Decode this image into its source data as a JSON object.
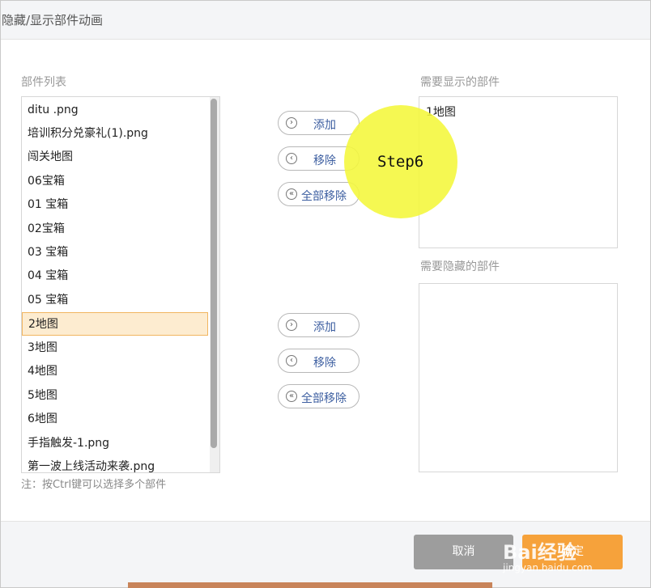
{
  "dialog": {
    "title": "隐藏/显示部件动画"
  },
  "left": {
    "label": "部件列表",
    "items": [
      "ditu .png",
      "培训积分兑豪礼(1).png",
      "闯关地图",
      "06宝箱",
      "01 宝箱",
      "02宝箱",
      "03 宝箱",
      "04 宝箱",
      "05 宝箱",
      "2地图",
      "3地图",
      "4地图",
      "5地图",
      "6地图",
      "手指触发-1.png",
      "第一波上线活动来袭.png"
    ],
    "selected_index": 9,
    "hint": "注：按Ctrl键可以选择多个部件"
  },
  "buttons_top": {
    "add": "添加",
    "remove": "移除",
    "remove_all": "全部移除"
  },
  "buttons_bottom": {
    "add": "添加",
    "remove": "移除",
    "remove_all": "全部移除"
  },
  "right": {
    "show_label": "需要显示的部件",
    "show_items": [
      "1地图"
    ],
    "hide_label": "需要隐藏的部件",
    "hide_items": []
  },
  "annotation": {
    "text": "Step6"
  },
  "footer": {
    "cancel": "取消",
    "confirm": "确定"
  },
  "watermark": {
    "brand": "Bai经验",
    "url": "jingyan.baidu.com"
  },
  "colors": {
    "accent": "#f6a23b",
    "cancel": "#9d9d9d",
    "selected_bg": "#fdecd0",
    "highlight": "#f4f73a"
  }
}
